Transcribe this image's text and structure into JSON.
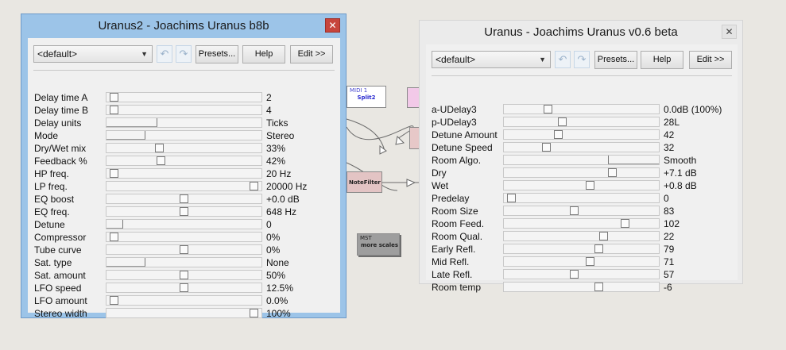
{
  "background": {
    "nodes": [
      {
        "id": "split",
        "tag": "MIDI 1",
        "label": "Split2"
      },
      {
        "id": "notefilter",
        "label": "NoteFilter"
      },
      {
        "id": "morescales",
        "tag": "MST",
        "label": "more scales"
      }
    ]
  },
  "win1": {
    "title": "Uranus2 - Joachims Uranus b8b",
    "preset": "<default>",
    "buttons": {
      "presets": "Presets...",
      "help": "Help",
      "edit": "Edit >>"
    },
    "params": [
      {
        "label": "Delay time A",
        "value": "2",
        "level": 0.02,
        "style": "thumb"
      },
      {
        "label": "Delay time B",
        "value": "4",
        "level": 0.02,
        "style": "thumb"
      },
      {
        "label": "Delay units",
        "value": "Ticks",
        "level": 0.33,
        "style": "fill"
      },
      {
        "label": "Mode",
        "value": "Stereo",
        "level": 0.25,
        "style": "fill"
      },
      {
        "label": "Dry/Wet mix",
        "value": "33%",
        "level": 0.33,
        "style": "thumb"
      },
      {
        "label": "Feedback %",
        "value": "42%",
        "level": 0.34,
        "style": "thumb"
      },
      {
        "label": "HP freq.",
        "value": "20 Hz",
        "level": 0.02,
        "style": "thumb"
      },
      {
        "label": "LP freq.",
        "value": "20000 Hz",
        "level": 0.98,
        "style": "thumb"
      },
      {
        "label": "EQ boost",
        "value": "+0.0 dB",
        "level": 0.5,
        "style": "thumb"
      },
      {
        "label": "EQ freq.",
        "value": "648 Hz",
        "level": 0.5,
        "style": "thumb"
      },
      {
        "label": "Detune",
        "value": "0",
        "level": 0.11,
        "style": "fill"
      },
      {
        "label": "Compressor",
        "value": "0%",
        "level": 0.02,
        "style": "thumb"
      },
      {
        "label": "Tube curve",
        "value": "0%",
        "level": 0.5,
        "style": "thumb"
      },
      {
        "label": "Sat. type",
        "value": "None",
        "level": 0.25,
        "style": "fill"
      },
      {
        "label": "Sat. amount",
        "value": "50%",
        "level": 0.5,
        "style": "thumb"
      },
      {
        "label": "LFO speed",
        "value": "12.5%",
        "level": 0.5,
        "style": "thumb"
      },
      {
        "label": "LFO amount",
        "value": "0.0%",
        "level": 0.02,
        "style": "thumb"
      },
      {
        "label": "Stereo width",
        "value": "100%",
        "level": 0.98,
        "style": "thumb"
      }
    ]
  },
  "win2": {
    "title": "Uranus - Joachims Uranus v0.6 beta",
    "preset": "<default>",
    "buttons": {
      "presets": "Presets...",
      "help": "Help",
      "edit": "Edit >>"
    },
    "params": [
      {
        "label": "a-UDelay3",
        "value": "0.0dB (100%)",
        "level": 0.27,
        "style": "thumb"
      },
      {
        "label": "p-UDelay3",
        "value": "28L",
        "level": 0.37,
        "style": "thumb"
      },
      {
        "label": "Detune Amount",
        "value": "42",
        "level": 0.34,
        "style": "thumb"
      },
      {
        "label": "Detune Speed",
        "value": "32",
        "level": 0.26,
        "style": "thumb"
      },
      {
        "label": "Room Algo.",
        "value": "Smooth",
        "level": 0.67,
        "style": "fillright"
      },
      {
        "label": "Dry",
        "value": "+7.1 dB",
        "level": 0.71,
        "style": "thumb"
      },
      {
        "label": "Wet",
        "value": "+0.8 dB",
        "level": 0.56,
        "style": "thumb"
      },
      {
        "label": "Predelay",
        "value": "0",
        "level": 0.02,
        "style": "thumb"
      },
      {
        "label": "Room Size",
        "value": "83",
        "level": 0.45,
        "style": "thumb"
      },
      {
        "label": "Room Feed.",
        "value": "102",
        "level": 0.8,
        "style": "thumb"
      },
      {
        "label": "Room Qual.",
        "value": "22",
        "level": 0.65,
        "style": "thumb"
      },
      {
        "label": "Early Refl.",
        "value": "79",
        "level": 0.62,
        "style": "thumb"
      },
      {
        "label": "Mid Refl.",
        "value": "71",
        "level": 0.56,
        "style": "thumb"
      },
      {
        "label": "Late Refl.",
        "value": "57",
        "level": 0.45,
        "style": "thumb"
      },
      {
        "label": "Room temp",
        "value": "-6",
        "level": 0.62,
        "style": "thumb"
      }
    ]
  }
}
